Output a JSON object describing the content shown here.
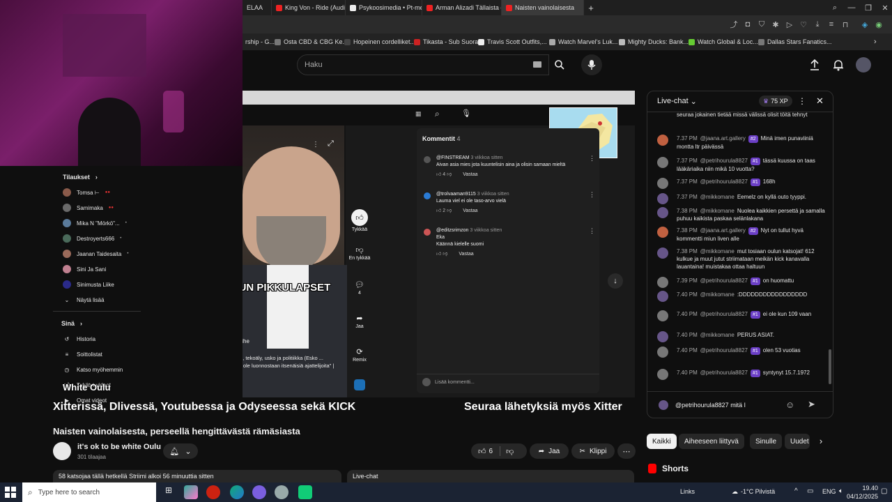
{
  "browser": {
    "tabs": [
      {
        "label": "ELAA",
        "active": false
      },
      {
        "label": "King Von - Ride (Audio) -",
        "active": false
      },
      {
        "label": "Psykoosimedia • Pt-medi",
        "active": false
      },
      {
        "label": "Arman Alizadi Tällaista on",
        "active": false
      },
      {
        "label": "Naisten vainolaisesta",
        "active": true
      }
    ],
    "bookmarks": [
      "rship - G...",
      "Osta CBD & CBG Ke...",
      "Hopeinen cordelliket...",
      "Tikasta - Sub Suora",
      "Travis Scott Outfits,...",
      "Watch Marvel's Luk...",
      "Mighty Ducks: Bank...",
      "Watch Global & Loc...",
      "Dallas Stars Fanatics..."
    ]
  },
  "header": {
    "search_placeholder": "Haku"
  },
  "sidebar": {
    "subs_title": "Tilaukset",
    "subs": [
      {
        "name": "Tomsa ⊢",
        "color": "#8a5a4a"
      },
      {
        "name": "Samimaka",
        "color": "#6a6a6a"
      },
      {
        "name": "Mika N \"Mörkö\"...",
        "color": "#5a7a9a"
      },
      {
        "name": "Destroyerts666",
        "color": "#4a6a5a"
      },
      {
        "name": "Jaanan Taidesaita",
        "color": "#9a6a5a"
      },
      {
        "name": "Sini Ja Sani",
        "color": "#c08090"
      },
      {
        "name": "Sinimusta Liike",
        "color": "#2a2a8a"
      }
    ],
    "show_more": "Näytä lisää",
    "you_title": "Sinä",
    "you_items": [
      "Historia",
      "Soittolistat",
      "Katso myöhemmin",
      "Tykätyt videot",
      "Omat videot"
    ],
    "overlay_name": "White Oulu"
  },
  "video": {
    "inner_comments_title": "Kommentit",
    "inner_comments_count": "4",
    "inner_comments": [
      {
        "user": "@FINSTREAM",
        "when": "3 viikkoa sitten",
        "text": "Aivan asia mies jota kuuntelisin aina ja olisin samaan mieltä",
        "likes": "4"
      },
      {
        "user": "@trolvaaman9115",
        "when": "3 viikkoa sitten",
        "text": "Lauma viel ei ole taso-arvo vielä",
        "likes": "2"
      },
      {
        "user": "@editzsrimzon",
        "when": "3 viikkoa sitten",
        "text": "Eka\nKäännä kielelle suomi",
        "likes": ""
      }
    ],
    "reply_label": "Vastaa",
    "add_comment": "Lisää kommentti...",
    "side_actions": {
      "like": "Tykkää",
      "dislike": "En tykkää",
      "comments": "4",
      "share": "Jaa",
      "remix": "Remix"
    },
    "caption": "KUN PIKKULAPSET",
    "channel_tag": "@puheenaihe",
    "inner_title": "Tiede, nöyryys, tekoäly, usko ja politiikka (Esko ...",
    "inner_sub": "\"Ihmiset eivät ole luonnostaan itsenäisiä ajattelijoita\" | Esko Valtaoja",
    "ticker_left": "Xitterissä, Dlivessä, Youtubessa ja Odyseessa sekä KICK",
    "ticker_right": "Seuraa lähetyksiä myös Xitter"
  },
  "below": {
    "title": "Naisten vainolaisesta, perseellä hengittävästä rämäsiasta",
    "channel": "it's ok to be white Oulu",
    "subscribers": "301 tilaajaa",
    "likes": "6",
    "share": "Jaa",
    "clip": "Klippi",
    "live_stats": "58 katsojaa tällä hetkellä  Striimi alkoi 56 minuuttia sitten",
    "live_chat_tab": "Live-chat"
  },
  "chat": {
    "title": "Live-chat",
    "xp": "75 XP",
    "messages": [
      {
        "time": "",
        "user": "",
        "badge": "",
        "text": "seuraa jokainen tietää missä välissä olisit töitä tehnyt",
        "avatar": "#555"
      },
      {
        "time": "7.37 PM",
        "user": "@jaana.art.gallery",
        "badge": "#2",
        "text": "Minä imen punaviiniä montta ltr päivässä",
        "avatar": "#c06040"
      },
      {
        "time": "7.37 PM",
        "user": "@petrihourula8827",
        "badge": "#1",
        "text": "tässä kuussa on taas lääkäriaika niin mikä 10 vuotta?",
        "avatar": "#777"
      },
      {
        "time": "7.37 PM",
        "user": "@petrihourula8827",
        "badge": "#1",
        "text": "168h",
        "avatar": "#777"
      },
      {
        "time": "7.37 PM",
        "user": "@mikkomane",
        "badge": "",
        "text": "Eemelz on kyllä outo tyyppi.",
        "avatar": "#665588"
      },
      {
        "time": "7.38 PM",
        "user": "@mikkomane",
        "badge": "",
        "text": "Nuolea kaikkien persettä ja samalla puhuu kaikista paskaa selänlakana",
        "avatar": "#665588"
      },
      {
        "time": "7.38 PM",
        "user": "@jaana.art.gallery",
        "badge": "#2",
        "text": "Nyt on tullut hyvä kommentti miun liven alle",
        "avatar": "#c06040"
      },
      {
        "time": "7.38 PM",
        "user": "@mikkomane",
        "badge": "",
        "text": "mut tosiaan oulun katsojat! 612 kulkue ja muut jutut striimataan meikän kick kanavalla lauantaina! muistakaa ottaa haltuun",
        "avatar": "#665588"
      },
      {
        "time": "7.39 PM",
        "user": "@petrihourula8827",
        "badge": "#1",
        "text": "on huomattu",
        "avatar": "#777"
      },
      {
        "time": "7.40 PM",
        "user": "@mikkomane",
        "badge": "",
        "text": ":DDDDDDDDDDDDDDDDD",
        "avatar": "#665588"
      },
      {
        "time": "7.40 PM",
        "user": "@petrihourula8827",
        "badge": "#1",
        "text": "ei ole kun 109 vaan",
        "avatar": "#777"
      },
      {
        "time": "7.40 PM",
        "user": "@mikkomane",
        "badge": "",
        "text": "PERUS ASIAT.",
        "avatar": "#665588"
      },
      {
        "time": "7.40 PM",
        "user": "@petrihourula8827",
        "badge": "#1",
        "text": "olen 53 vuotias",
        "avatar": "#777"
      },
      {
        "time": "7.40 PM",
        "user": "@petrihourula8827",
        "badge": "#1",
        "text": "syntynyt 15.7.1972",
        "avatar": "#777"
      }
    ],
    "input_value": "@petrihourula8827 mitä l"
  },
  "filters": [
    "Kaikki",
    "Aiheeseen liittyvä",
    "Sinulle",
    "Uudet"
  ],
  "shorts_title": "Shorts",
  "taskbar": {
    "search_placeholder": "Type here to search",
    "links": "Links",
    "weather": "-1°C  Pilvistä",
    "lang": "ENG",
    "time": "19.40",
    "date": "04/12/2025"
  }
}
